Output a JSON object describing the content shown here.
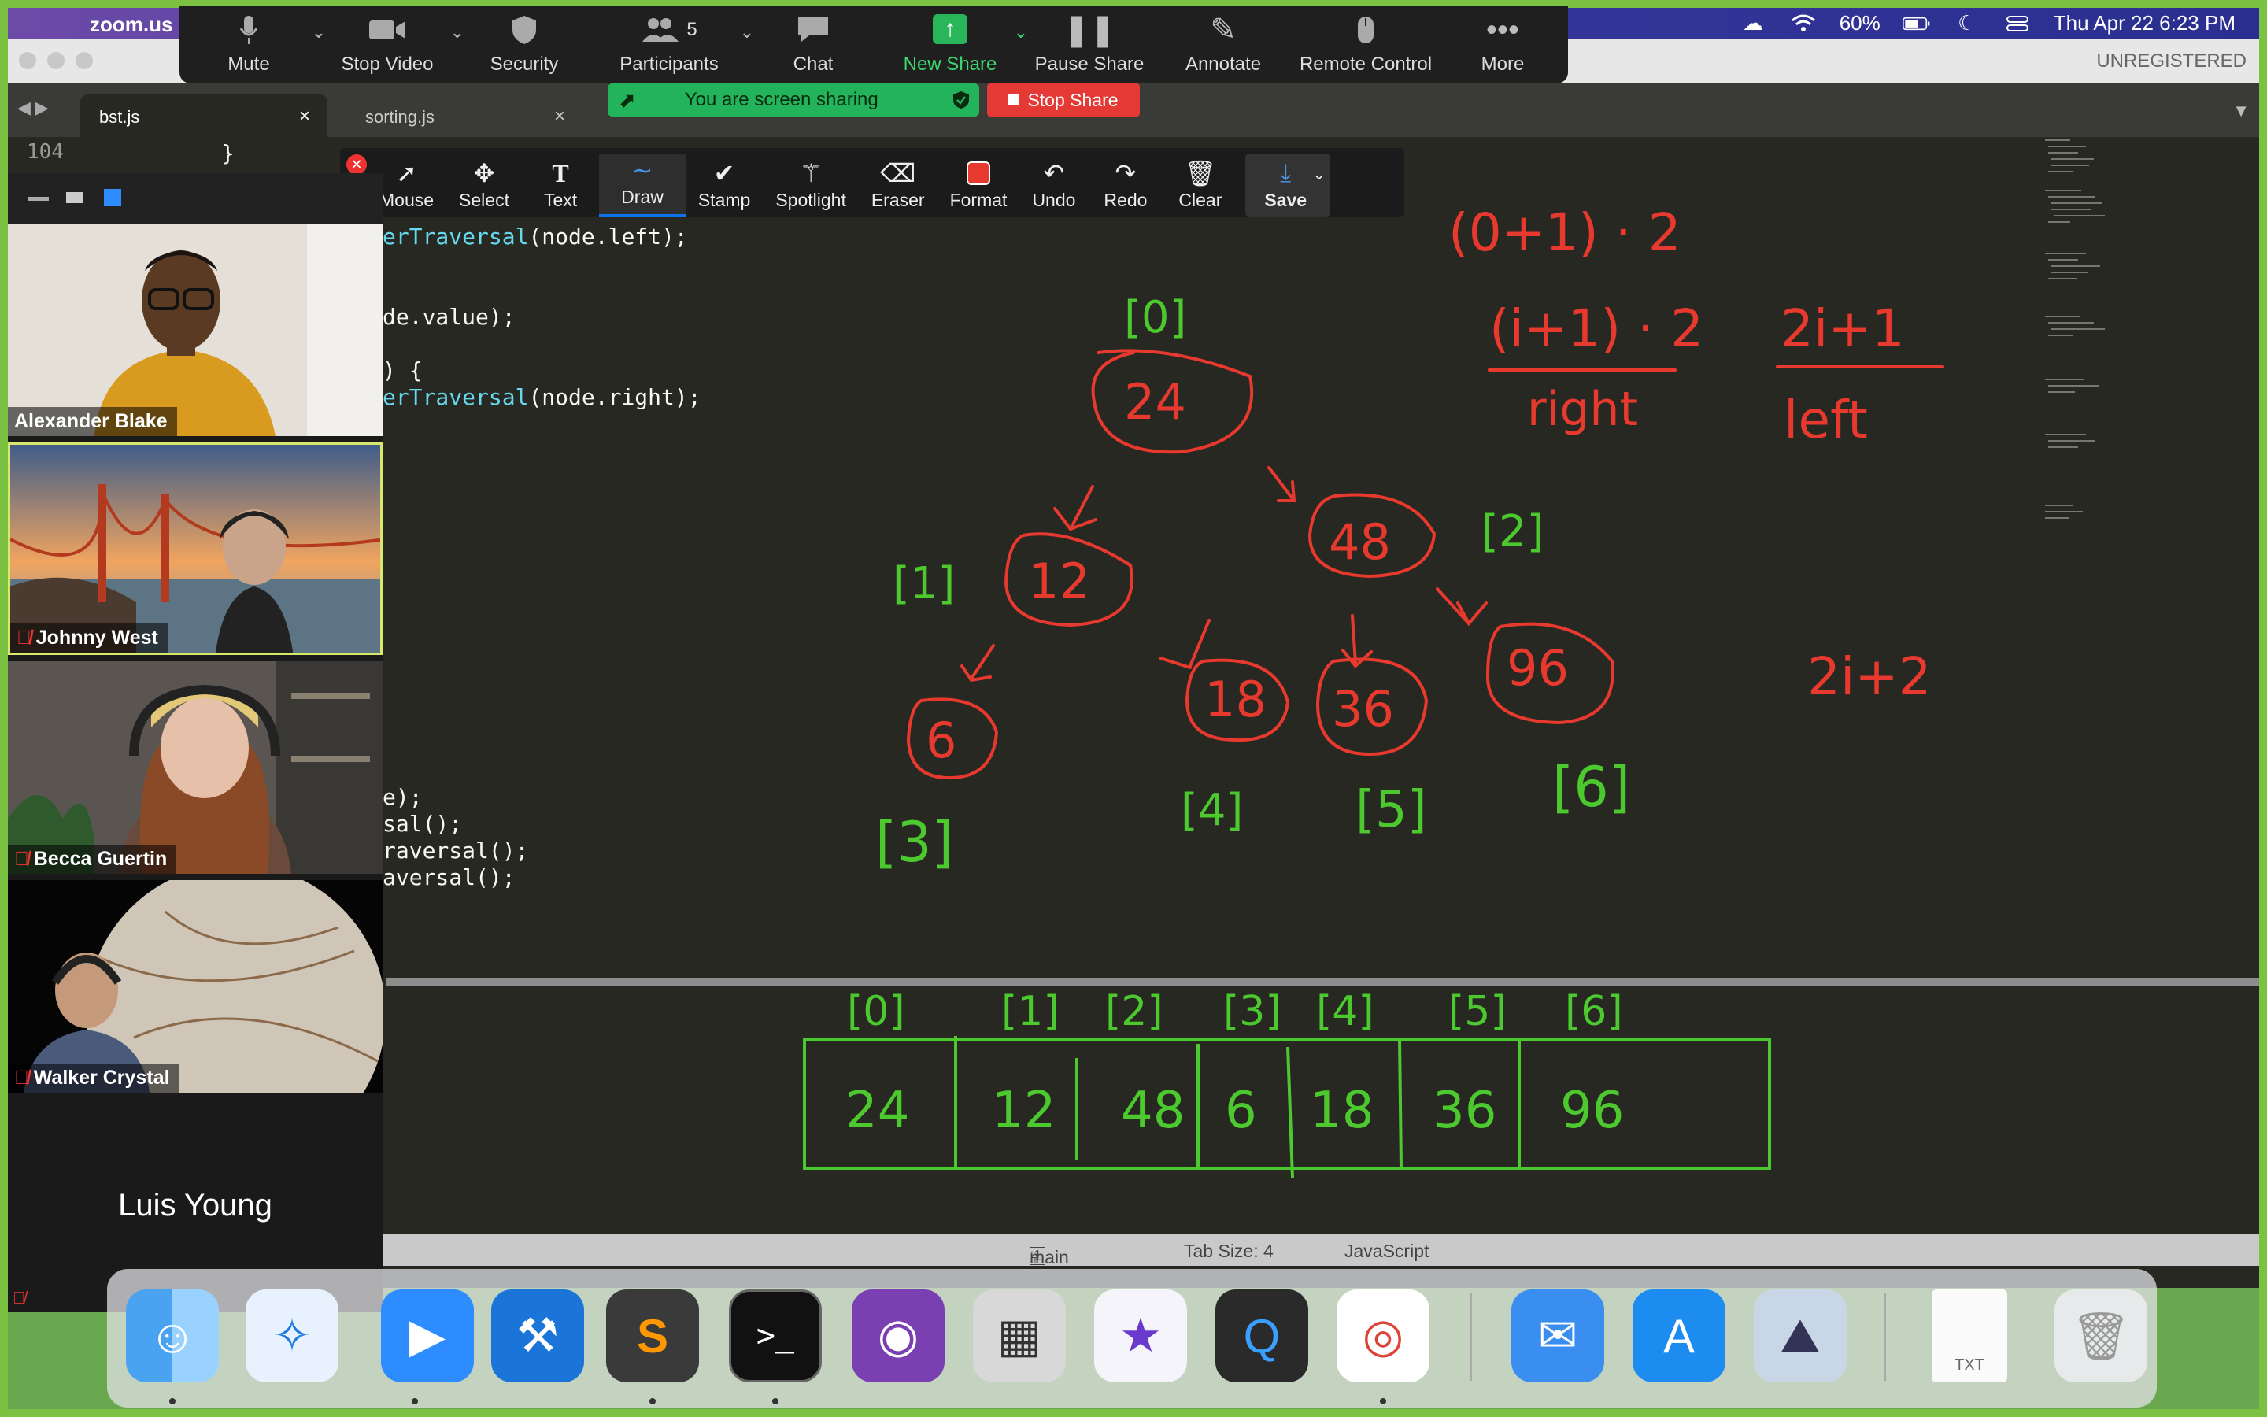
{
  "menubar": {
    "app_name": "zoom.us",
    "battery": "60%",
    "datetime": "Thu Apr 22  6:23 PM"
  },
  "window": {
    "unregistered": "UNREGISTERED"
  },
  "zoom_toolbar": {
    "mute": "Mute",
    "stop_video": "Stop Video",
    "security": "Security",
    "participants": "Participants",
    "participants_count": "5",
    "chat": "Chat",
    "new_share": "New Share",
    "pause_share": "Pause Share",
    "annotate": "Annotate",
    "remote_control": "Remote Control",
    "more": "More"
  },
  "share_status": {
    "message": "You are screen sharing",
    "stop": "Stop Share"
  },
  "tabs": [
    {
      "label": "bst.js",
      "active": true
    },
    {
      "label": "sorting.js",
      "active": false
    }
  ],
  "editor": {
    "line_number": "104",
    "lines": {
      "l0": "      }",
      "l1_fn": "erTraversal",
      "l1_rest": "(node.left);",
      "l2": "de.value);",
      "l3": ") {",
      "l4_fn": "erTraversal",
      "l4_rest": "(node.right);",
      "l5": "e);",
      "l6": "sal();",
      "l7": "raversal();",
      "l8": "aversal();"
    }
  },
  "annotate_toolbar": {
    "mouse": "Mouse",
    "select": "Select",
    "text": "Text",
    "draw": "Draw",
    "stamp": "Stamp",
    "spotlight": "Spotlight",
    "eraser": "Eraser",
    "format": "Format",
    "undo": "Undo",
    "redo": "Redo",
    "clear": "Clear",
    "save": "Save"
  },
  "participants": [
    {
      "name": "Alexander Blake",
      "muted": false
    },
    {
      "name": "Johnny West",
      "muted": true
    },
    {
      "name": "Becca Guertin",
      "muted": true
    },
    {
      "name": "Walker Crystal",
      "muted": true
    },
    {
      "name": "Luis Young",
      "muted": true
    }
  ],
  "statusbar": {
    "branch": "main",
    "branch_count": "1",
    "tab_size": "Tab Size: 4",
    "language": "JavaScript"
  },
  "annotations": {
    "red": {
      "formula_top": "(0+1) · 2",
      "formula_right": "(i+1) · 2",
      "formula_left": "2i+1",
      "label_right": "right",
      "label_left": "left",
      "formula_other": "2i+2",
      "tree_values": [
        "24",
        "12",
        "48",
        "6",
        "18",
        "36",
        "96"
      ]
    },
    "green": {
      "tree_indices": [
        "[0]",
        "[1]",
        "[2]",
        "[3]",
        "[4]",
        "[5]",
        "[6]"
      ],
      "array_indices": [
        "[0]",
        "[1]",
        "[2]",
        "[3]",
        "[4]",
        "[5]",
        "[6]"
      ],
      "array_values": [
        "24",
        "12",
        "48",
        "6",
        "18",
        "36",
        "96"
      ]
    }
  },
  "dock": {
    "apps": [
      "Finder",
      "Safari",
      "Zoom",
      "Xcode",
      "Sublime Text",
      "Terminal",
      "GitHub Desktop",
      "Calculator",
      "iMovie",
      "QuickTime",
      "Chrome",
      "Mail",
      "App Store",
      "Preview",
      "TXT",
      "Trash"
    ],
    "txt_label": "TXT"
  },
  "colors": {
    "share_green": "#7bc142",
    "annotation_red": "#e8392e",
    "annotation_green": "#4cc92e",
    "editor_bg": "#272822",
    "zoom_toolbar": "#1f1f1f"
  }
}
